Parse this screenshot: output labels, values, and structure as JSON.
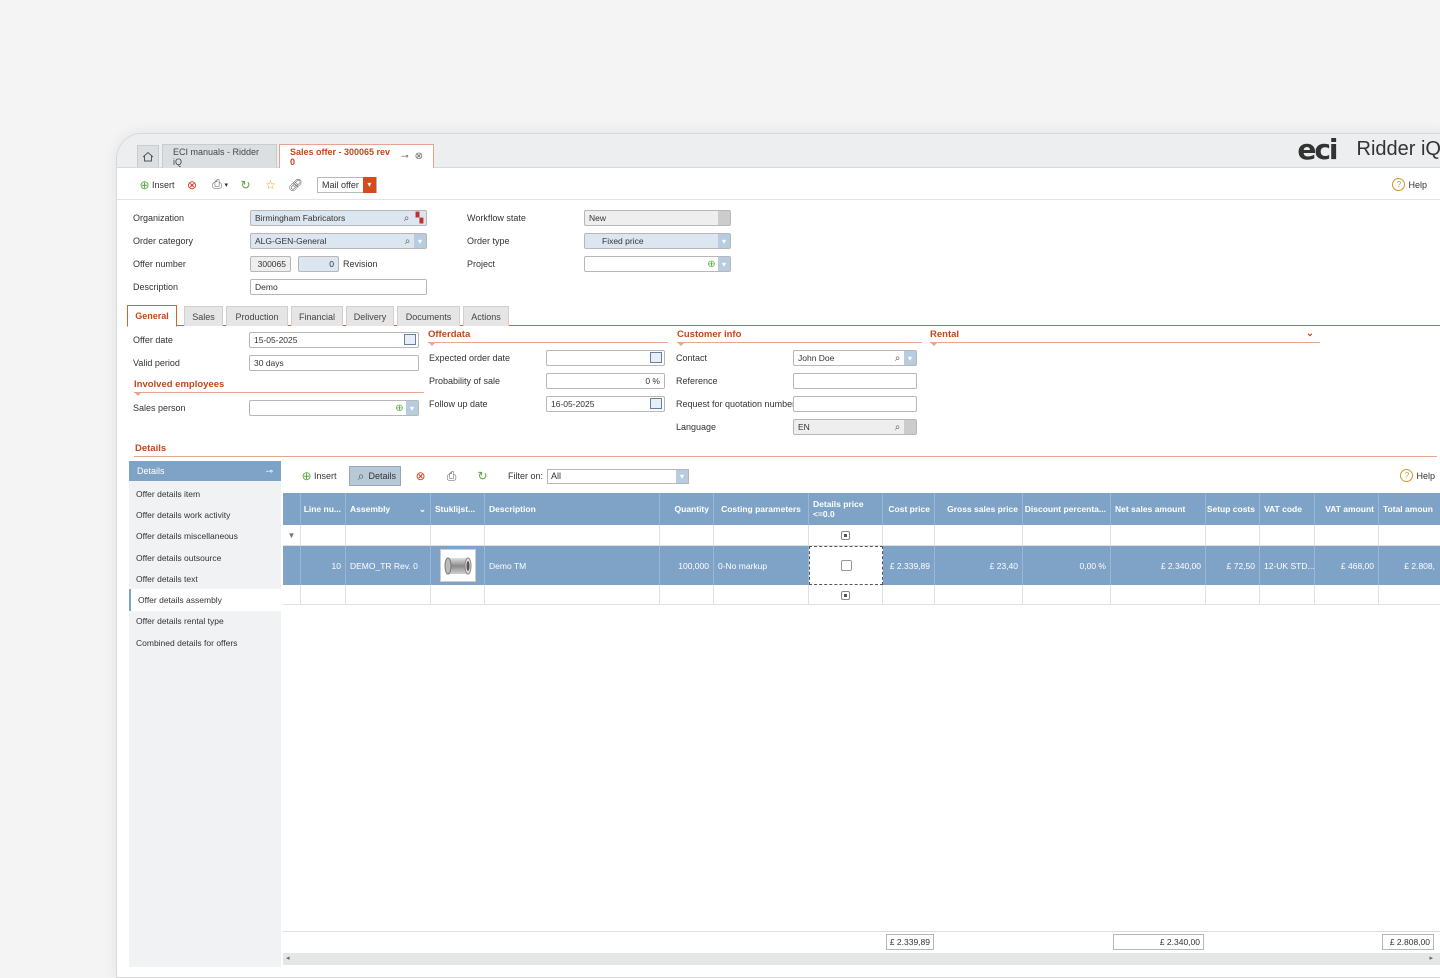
{
  "tabs": {
    "inactive": "ECI manuals - Ridder iQ",
    "active": "Sales offer - 300065 rev 0"
  },
  "brand": {
    "eci": "eci",
    "product": "Ridder iQ"
  },
  "toolbar": {
    "insert": "Insert",
    "mail_offer": "Mail offer",
    "help": "Help"
  },
  "header": {
    "organization_label": "Organization",
    "organization": "Birmingham Fabricators",
    "order_category_label": "Order category",
    "order_category": "ALG-GEN-General",
    "offer_number_label": "Offer number",
    "offer_number": "300065",
    "revision_value": "0",
    "revision_label": "Revision",
    "description_label": "Description",
    "description": "Demo",
    "workflow_state_label": "Workflow state",
    "workflow_state": "New",
    "order_type_label": "Order type",
    "order_type": "Fixed price",
    "project_label": "Project",
    "project": ""
  },
  "page_tabs": [
    "General",
    "Sales",
    "Production",
    "Financial",
    "Delivery",
    "Documents",
    "Actions"
  ],
  "general": {
    "offer_date_label": "Offer date",
    "offer_date": "15-05-2025",
    "valid_period_label": "Valid period",
    "valid_period": "30 days",
    "involved_employees": "Involved employees",
    "sales_person_label": "Sales person",
    "sales_person": ""
  },
  "offerdata": {
    "title": "Offerdata",
    "expected_order_date_label": "Expected order date",
    "expected_order_date": "",
    "probability_label": "Probability of sale",
    "probability": "0 %",
    "follow_up_label": "Follow up date",
    "follow_up": "16-05-2025"
  },
  "customer": {
    "title": "Customer info",
    "contact_label": "Contact",
    "contact": "John Doe",
    "reference_label": "Reference",
    "reference": "",
    "rfq_label": "Request for quotation number",
    "rfq": "",
    "language_label": "Language",
    "language": "EN"
  },
  "rental": {
    "title": "Rental"
  },
  "details": {
    "title": "Details",
    "side_title": "Details",
    "side_items": [
      "Offer details item",
      "Offer details work activity",
      "Offer details miscellaneous",
      "Offer details outsource",
      "Offer details text",
      "Offer details assembly",
      "Offer details rental type",
      "Combined details for offers"
    ],
    "insert": "Insert",
    "details_btn": "Details",
    "filter_label": "Filter on:",
    "filter_value": "All",
    "help": "Help"
  },
  "grid": {
    "columns": [
      "Line nu...",
      "Assembly",
      "Stuklijst...",
      "Description",
      "Quantity",
      "Costing parameters",
      "Details price <=0.0",
      "Cost price",
      "Gross sales price",
      "Discount percenta...",
      "Net sales amount",
      "Setup costs",
      "VAT code",
      "VAT amount",
      "Total amoun"
    ],
    "row": {
      "line": "10",
      "assembly": "DEMO_TR Rev. 0",
      "description": "Demo TM",
      "quantity": "100,000",
      "costing": "0-No markup",
      "cost_price": "£ 2.339,89",
      "gross": "£ 23,40",
      "discount": "0,00 %",
      "net": "£ 2.340,00",
      "setup": "£ 72,50",
      "vat_code": "12-UK STD...",
      "vat_amount": "£ 468,00",
      "total": "£ 2.808,"
    },
    "totals": {
      "cost_price": "£ 2.339,89",
      "net": "£ 2.340,00",
      "total": "£ 2.808,00"
    }
  },
  "colors": {
    "accent": "#c4471a",
    "grid_header": "#7fa3c7"
  }
}
